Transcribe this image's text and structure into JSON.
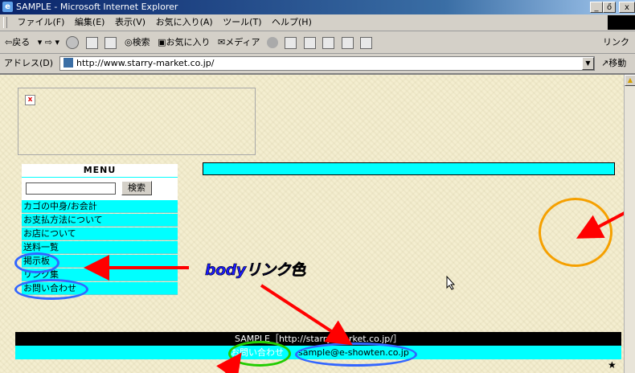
{
  "window": {
    "title": "SAMPLE - Microsoft Internet Explorer",
    "min": "_",
    "max": "ő",
    "close": "x"
  },
  "menubar": [
    "ファイル(F)",
    "編集(E)",
    "表示(V)",
    "お気に入り(A)",
    "ツール(T)",
    "ヘルプ(H)"
  ],
  "toolbar": {
    "back": "⇦戻る",
    "search": "◎検索",
    "favorites": "▣お気に入り",
    "media": "✉メディア",
    "links": "リンク"
  },
  "addressbar": {
    "label": "アドレス(D)",
    "url": "http://www.starry-market.co.jp/",
    "go": "↗移動"
  },
  "page": {
    "menu_title": "MENU",
    "search_button": "検索",
    "menu_items": [
      "カゴの中身/お会計",
      "お支払方法について",
      "お店について",
      "送料一覧",
      "掲示板",
      "リンク集",
      "お問い合わせ"
    ],
    "footer_text": "SAMPLE［http://starry-market.co.jp/］",
    "footer_contact": "お問い合わせ",
    "footer_email": "sample@e-showten.co.jp"
  },
  "annotation": {
    "label": "bodyリンク色",
    "colors": {
      "arrow": "#ff0000",
      "blue_ring": "#3366ff",
      "green_ring": "#22cc00",
      "orange_ring": "#f5a000"
    }
  },
  "icons": [
    "ie-logo-icon",
    "broken-image-icon",
    "back-arrow-icon",
    "forward-arrow-icon",
    "stop-icon",
    "refresh-icon",
    "home-icon",
    "cursor-icon"
  ]
}
